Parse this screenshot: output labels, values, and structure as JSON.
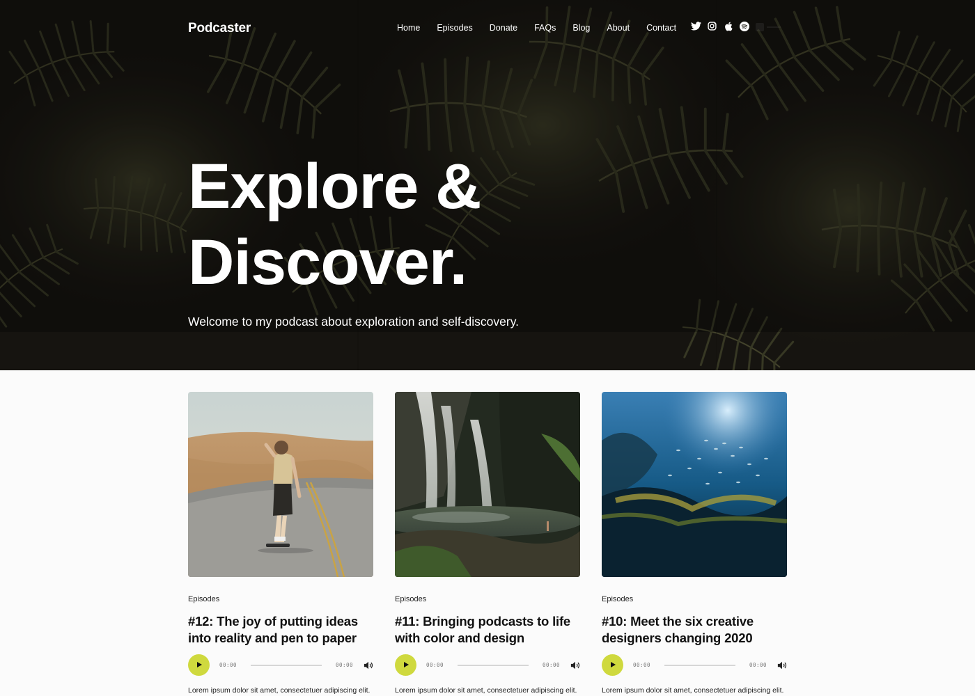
{
  "site": {
    "brand": "Podcaster"
  },
  "nav": {
    "items": [
      {
        "label": "Home"
      },
      {
        "label": "Episodes"
      },
      {
        "label": "Donate"
      },
      {
        "label": "FAQs"
      },
      {
        "label": "Blog"
      },
      {
        "label": "About"
      },
      {
        "label": "Contact"
      }
    ],
    "socials": [
      {
        "icon": "twitter-icon"
      },
      {
        "icon": "instagram-icon"
      },
      {
        "icon": "apple-icon"
      },
      {
        "icon": "spotify-icon"
      }
    ]
  },
  "hero": {
    "title_line1": "Explore &",
    "title_line2": "Discover.",
    "subtitle": "Welcome to my podcast about exploration and self-discovery."
  },
  "episodes": [
    {
      "image": "skateboarder-on-road",
      "category": "Episodes",
      "title": "#12: The joy of putting ideas into reality and pen to paper",
      "time_current": "00:00",
      "time_duration": "00:00",
      "excerpt": "Lorem ipsum dolor sit amet, consectetuer adipiscing elit."
    },
    {
      "image": "waterfall-in-forest",
      "category": "Episodes",
      "title": "#11: Bringing podcasts to life with color and design",
      "time_current": "00:00",
      "time_duration": "00:00",
      "excerpt": "Lorem ipsum dolor sit amet, consectetuer adipiscing elit."
    },
    {
      "image": "underwater-reef-with-fish",
      "category": "Episodes",
      "title": "#10: Meet the six creative designers changing 2020",
      "time_current": "00:00",
      "time_duration": "00:00",
      "excerpt": "Lorem ipsum dolor sit amet, consectetuer adipiscing elit."
    }
  ],
  "colors": {
    "accent": "#cfd93e",
    "hero_bg": "#161410",
    "page_bg": "#fbfbfb"
  }
}
